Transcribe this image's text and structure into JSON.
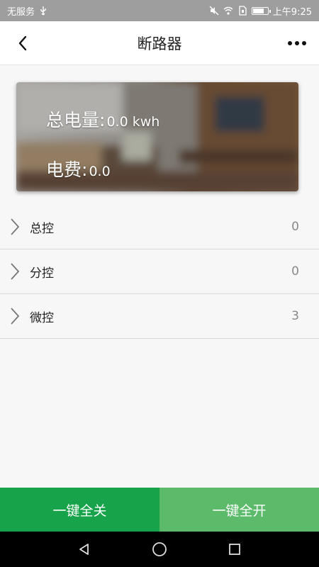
{
  "status_bar": {
    "carrier": "无服务",
    "time": "上午9:25",
    "icons": [
      "usb-icon",
      "mute-icon",
      "wifi-icon",
      "sim-icon",
      "battery-icon"
    ]
  },
  "header": {
    "title": "断路器",
    "back_icon": "back-arrow-icon",
    "more_icon": "more-dots-icon"
  },
  "summary": {
    "total_label": "总电量:",
    "total_value": "0.0 kwh",
    "fee_label": "电费:",
    "fee_value": "0.0"
  },
  "groups": [
    {
      "label": "总控",
      "count": "0"
    },
    {
      "label": "分控",
      "count": "0"
    },
    {
      "label": "微控",
      "count": "3"
    }
  ],
  "actions": {
    "all_off": "一键全关",
    "all_on": "一键全开"
  },
  "colors": {
    "all_off_bg": "#16a34a",
    "all_on_bg": "#5cba6b",
    "status_bar_bg": "#9e9e9e"
  }
}
